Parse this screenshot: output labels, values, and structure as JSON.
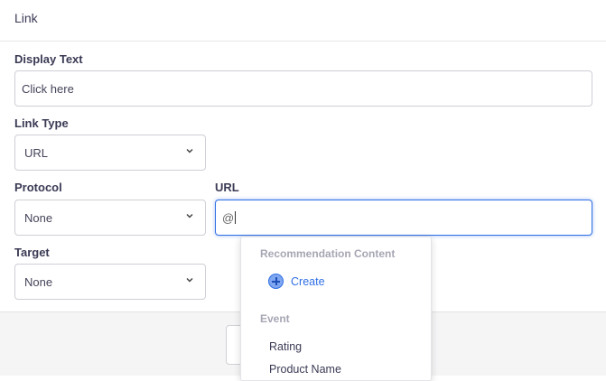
{
  "header": {
    "title": "Link"
  },
  "form": {
    "display_text": {
      "label": "Display Text",
      "value": "Click here"
    },
    "link_type": {
      "label": "Link Type",
      "value": "URL"
    },
    "protocol": {
      "label": "Protocol",
      "value": "None"
    },
    "url": {
      "label": "URL",
      "value": "@"
    },
    "target": {
      "label": "Target",
      "value": "None"
    }
  },
  "dropdown": {
    "section1": "Recommendation Content",
    "create": "Create",
    "section2": "Event",
    "items": [
      "Rating",
      "Product Name"
    ]
  }
}
